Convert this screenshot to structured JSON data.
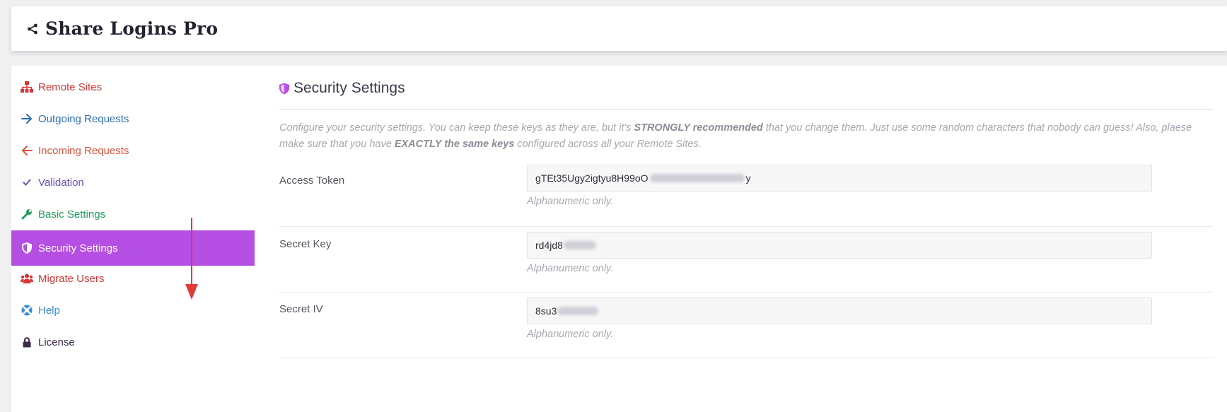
{
  "header": {
    "title": "Share Logins Pro",
    "icon": "share-icon"
  },
  "sidebar": {
    "items": [
      {
        "label": "Remote Sites",
        "icon": "sitemap-icon",
        "color": "#d63638"
      },
      {
        "label": "Outgoing Requests",
        "icon": "arrow-right-icon",
        "color": "#2d6fb5"
      },
      {
        "label": "Incoming Requests",
        "icon": "arrow-left-icon",
        "color": "#e0533a"
      },
      {
        "label": "Validation",
        "icon": "check-icon",
        "color": "#6b4fbb"
      },
      {
        "label": "Basic Settings",
        "icon": "wrench-icon",
        "color": "#1f9d5a"
      },
      {
        "label": "Security Settings",
        "icon": "shield-icon",
        "color": "#ffffff",
        "active": true
      },
      {
        "label": "Migrate Users",
        "icon": "users-icon",
        "color": "#d63638"
      },
      {
        "label": "Help",
        "icon": "life-ring-icon",
        "color": "#3a8ed6"
      },
      {
        "label": "License",
        "icon": "lock-icon",
        "color": "#3a2a4a"
      }
    ]
  },
  "main": {
    "title": "Security Settings",
    "title_icon": "shield-icon",
    "description": {
      "part1": "Configure your security settings. You can keep these keys as they are, but it's ",
      "strong1": "STRONGLY recommended",
      "part2": " that you change them. Just use some random characters that nobody can guess! Also, plaese make sure that you have ",
      "strong2": "EXACTLY the same keys",
      "part3": " configured across all your Remote Sites."
    },
    "fields": [
      {
        "label": "Access Token",
        "value": "gTEt35Ugy2igtyu8H99oO",
        "value_tail": "y",
        "hint": "Alphanumeric only."
      },
      {
        "label": "Secret Key",
        "value": "rd4jd8",
        "hint": "Alphanumeric only."
      },
      {
        "label": "Secret IV",
        "value": "8su3",
        "hint": "Alphanumeric only."
      }
    ]
  },
  "annotation": {
    "arrow_color": "#e03c3c"
  },
  "colors": {
    "accent": "#b54fe4"
  }
}
